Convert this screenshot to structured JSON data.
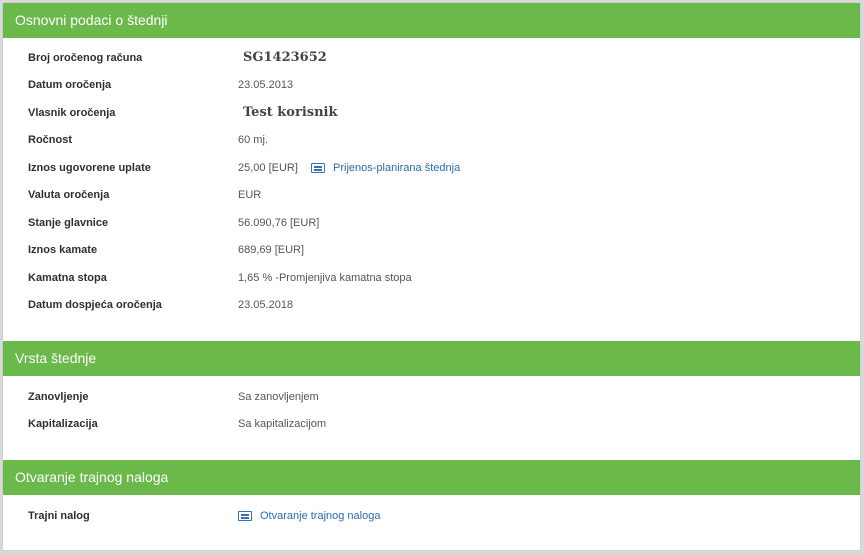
{
  "sections": [
    {
      "title": "Osnovni podaci o štednji",
      "rows": [
        {
          "label": "Broj oročenog računa",
          "value": "SG1423652"
        },
        {
          "label": "Datum oročenja",
          "value": "23.05.2013"
        },
        {
          "label": "Vlasnik oročenja",
          "value": "Test korisnik"
        },
        {
          "label": "Ročnost",
          "value": "60 mj."
        },
        {
          "label": "Iznos ugovorene uplate",
          "value": "25,00 [EUR]",
          "link": {
            "text": "Prijenos-planirana štednja",
            "icon": "list-icon"
          }
        },
        {
          "label": "Valuta oročenja",
          "value": "EUR"
        },
        {
          "label": "Stanje glavnice",
          "value": "56.090,76 [EUR]"
        },
        {
          "label": "Iznos kamate",
          "value": "689,69 [EUR]"
        },
        {
          "label": "Kamatna stopa",
          "value": "1,65 % -Promjenjiva kamatna stopa"
        },
        {
          "label": "Datum dospjeća oročenja",
          "value": "23.05.2018"
        }
      ]
    },
    {
      "title": "Vrsta štednje",
      "rows": [
        {
          "label": "Zanovljenje",
          "value": "Sa zanovljenjem"
        },
        {
          "label": "Kapitalizacija",
          "value": "Sa kapitalizacijom"
        }
      ]
    },
    {
      "title": "Otvaranje trajnog naloga",
      "rows": [
        {
          "label": "Trajni nalog",
          "link": {
            "text": "Otvaranje trajnog naloga",
            "icon": "list-icon"
          }
        }
      ]
    }
  ],
  "colors": {
    "header_bg": "#6ab94a",
    "header_text": "#ffffff",
    "link": "#2b6cb0"
  }
}
